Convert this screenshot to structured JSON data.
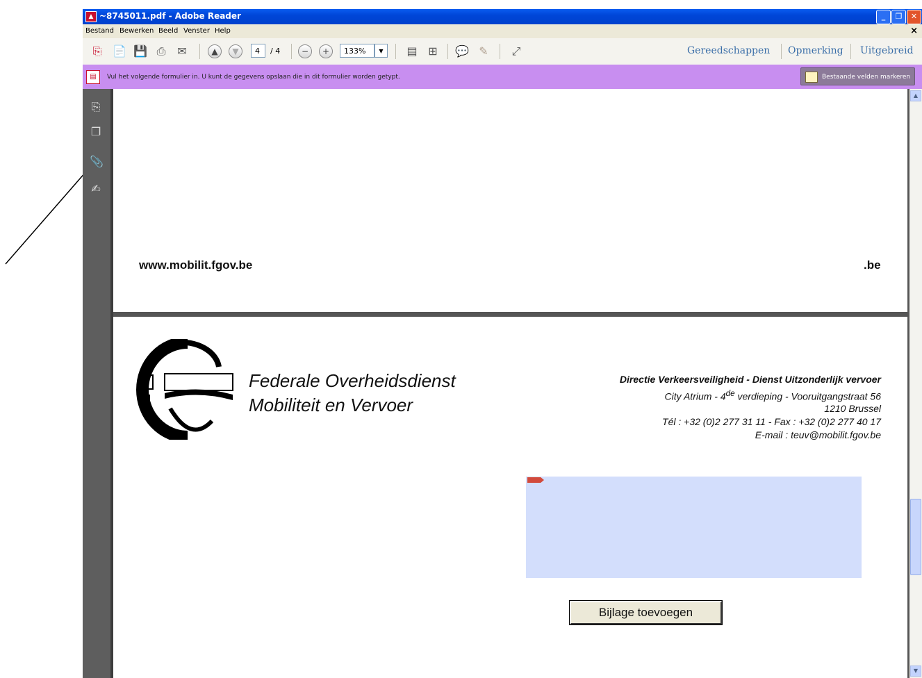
{
  "window": {
    "title": "~8745011.pdf - Adobe Reader",
    "buttons": [
      "minimize",
      "restore",
      "close"
    ]
  },
  "menu": {
    "items": [
      "Bestand",
      "Bewerken",
      "Beeld",
      "Venster",
      "Help"
    ],
    "close_glyph": "×"
  },
  "toolbar": {
    "page_current": "4",
    "page_total": "/ 4",
    "zoom": "133%",
    "right_links": [
      "Gereedschappen",
      "Opmerking",
      "Uitgebreid"
    ]
  },
  "notice": {
    "text": "Vul het volgende formulier in. U kunt de gegevens opslaan die in dit formulier worden getypt.",
    "button": "Bestaande velden markeren"
  },
  "document": {
    "page3": {
      "url": "www.mobilit.fgov.be",
      "suffix": ".be"
    },
    "page4": {
      "org_line1": "Federale Overheidsdienst",
      "org_line2": "Mobiliteit en Vervoer",
      "address": {
        "line1": "Directie Verkeersveiligheid - Dienst Uitzonderlijk vervoer",
        "line2_pre": "City Atrium  - 4",
        "line2_sup": "de",
        "line2_post": " verdieping - Vooruitgangstraat 56",
        "line3": "1210 Brussel",
        "line4": "Tél : +32 (0)2 277 31 11 - Fax : +32 (0)2 277 40 17",
        "line5": "E-mail : teuv@mobilit.fgov.be"
      },
      "attach_button": "Bijlage toevoegen"
    }
  },
  "colors": {
    "titlebar": "#0046d8",
    "notice_bar": "#c88ef0",
    "form_field": "#d3defc",
    "link": "#3a6ea8"
  }
}
